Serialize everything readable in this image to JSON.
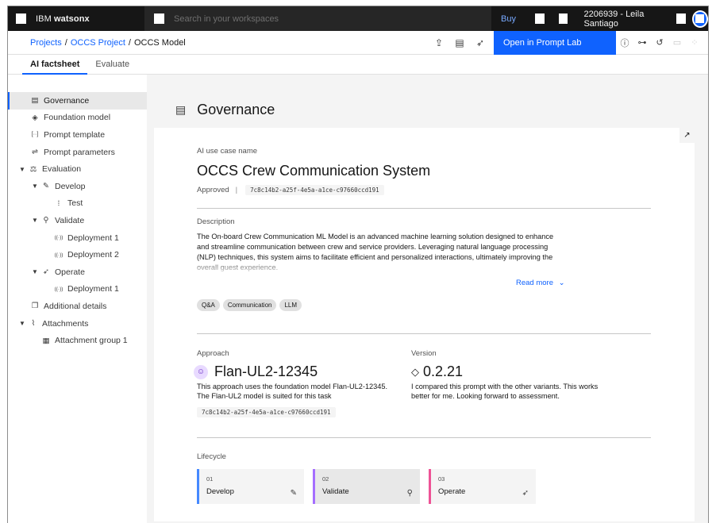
{
  "topbar": {
    "brand_prefix": "IBM",
    "brand_name": "watsonx",
    "search_placeholder": "Search in your workspaces",
    "buy_label": "Buy",
    "user_label": "2206939 - Leila Santiago"
  },
  "breadcrumb": {
    "items": [
      "Projects",
      "OCCS Project",
      "OCCS Model"
    ],
    "separator": "/"
  },
  "toolbar": {
    "open_prompt_lab_label": "Open in Prompt Lab"
  },
  "tabs": [
    {
      "label": "AI factsheet",
      "active": true
    },
    {
      "label": "Evaluate",
      "active": false
    }
  ],
  "sidebar": {
    "items": [
      {
        "label": "Governance",
        "icon": "governance-icon",
        "glyph": "▤",
        "indent": 0,
        "chevron": false,
        "active": true
      },
      {
        "label": "Foundation model",
        "icon": "gem-icon",
        "glyph": "◈",
        "indent": 0,
        "chevron": false
      },
      {
        "label": "Prompt template",
        "icon": "brackets-icon",
        "glyph": "[··]",
        "indent": 0,
        "chevron": false
      },
      {
        "label": "Prompt parameters",
        "icon": "sliders-icon",
        "glyph": "⇌",
        "indent": 0,
        "chevron": false
      },
      {
        "label": "Evaluation",
        "icon": "scale-icon",
        "glyph": "⚖",
        "indent": 0,
        "chevron": true
      },
      {
        "label": "Develop",
        "icon": "wrench-icon",
        "glyph": "✎",
        "indent": 1,
        "chevron": true
      },
      {
        "label": "Test",
        "icon": "test-icon",
        "glyph": "⁞",
        "indent": 2,
        "chevron": false
      },
      {
        "label": "Validate",
        "icon": "stamp-icon",
        "glyph": "⚲",
        "indent": 1,
        "chevron": true
      },
      {
        "label": "Deployment 1",
        "icon": "broadcast-icon",
        "glyph": "((·))",
        "indent": 2,
        "chevron": false
      },
      {
        "label": "Deployment 2",
        "icon": "broadcast-icon",
        "glyph": "((·))",
        "indent": 2,
        "chevron": false
      },
      {
        "label": "Operate",
        "icon": "rocket-icon",
        "glyph": "➶",
        "indent": 1,
        "chevron": true
      },
      {
        "label": "Deployment 1",
        "icon": "broadcast-icon",
        "glyph": "((·))",
        "indent": 2,
        "chevron": false
      },
      {
        "label": "Additional details",
        "icon": "details-icon",
        "glyph": "❐",
        "indent": 0,
        "chevron": false
      },
      {
        "label": "Attachments",
        "icon": "paperclip-icon",
        "glyph": "⌇",
        "indent": 0,
        "chevron": true
      },
      {
        "label": "Attachment group 1",
        "icon": "group-icon",
        "glyph": "▦",
        "indent": 1,
        "chevron": false
      }
    ]
  },
  "main": {
    "section_title": "Governance",
    "use_case_label": "AI use case name",
    "use_case_name": "OCCS Crew Communication System",
    "status": "Approved",
    "use_case_id": "7c8c14b2-a25f-4e5a-a1ce-c97660ccd191",
    "description_label": "Description",
    "description": "The On-board Crew Communication ML Model is an advanced machine learning solution designed to enhance and streamline communication between crew and service providers. Leveraging natural language processing (NLP) techniques, this system aims to facilitate efficient and personalized interactions, ultimately improving the overall guest experience.",
    "read_more": "Read more",
    "tags": [
      "Q&A",
      "Communication",
      "LLM"
    ],
    "approach_label": "Approach",
    "approach_name": "Flan-UL2-12345",
    "approach_desc": "This approach uses the foundation model Flan-UL2-12345. The Flan-UL2 model is suited for this task",
    "approach_id": "7c8c14b2-a25f-4e5a-a1ce-c97660ccd191",
    "version_label": "Version",
    "version": "0.2.21",
    "version_desc": "I compared this prompt with the other variants. This works better for me. Looking forward to assessment.",
    "lifecycle_label": "Lifecycle",
    "lifecycle": [
      {
        "num": "01",
        "name": "Develop",
        "color": "#4589ff",
        "icon": "wrench-icon",
        "glyph": "✎",
        "selected": false
      },
      {
        "num": "02",
        "name": "Validate",
        "color": "#a56eff",
        "icon": "stamp-icon",
        "glyph": "⚲",
        "selected": true
      },
      {
        "num": "03",
        "name": "Operate",
        "color": "#ee5396",
        "icon": "rocket-icon",
        "glyph": "➶",
        "selected": false
      }
    ]
  }
}
